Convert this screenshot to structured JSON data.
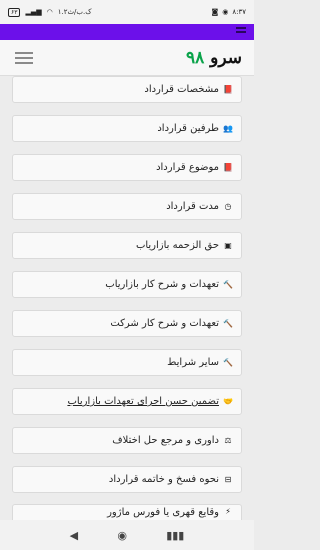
{
  "status": {
    "time": "۸:۳۷",
    "data_rate": "۱.۲ک.ب/ث",
    "battery": "۶۳"
  },
  "brand": {
    "name": "سرو",
    "number": "۹۸"
  },
  "items": [
    {
      "label": "مشخصات قرارداد",
      "icon": "book-icon"
    },
    {
      "label": "طرفین قرارداد",
      "icon": "users-icon"
    },
    {
      "label": "موضوع قرارداد",
      "icon": "book-icon"
    },
    {
      "label": "مدت قرارداد",
      "icon": "clock-icon"
    },
    {
      "label": "حق الزحمه بازاریاب",
      "icon": "money-icon"
    },
    {
      "label": "تعهدات و شرح کار بازاریاب",
      "icon": "gavel-icon"
    },
    {
      "label": "تعهدات و شرح کار شرکت",
      "icon": "gavel-icon"
    },
    {
      "label": "سایر شرایط",
      "icon": "gavel-icon"
    },
    {
      "label": "تضمین حسن اجرای تعهدات بازاریاب",
      "icon": "handshake-icon"
    },
    {
      "label": "داوری و مرجع حل اختلاف",
      "icon": "scale-icon"
    },
    {
      "label": "نحوه فسخ و خاتمه قرارداد",
      "icon": "minus-square-icon"
    },
    {
      "label": "وقایع قهری یا فورس ماژور",
      "icon": "bolt-icon"
    }
  ],
  "icons": {
    "back": "back-icon",
    "home": "home-icon",
    "recents": "recents-icon"
  }
}
